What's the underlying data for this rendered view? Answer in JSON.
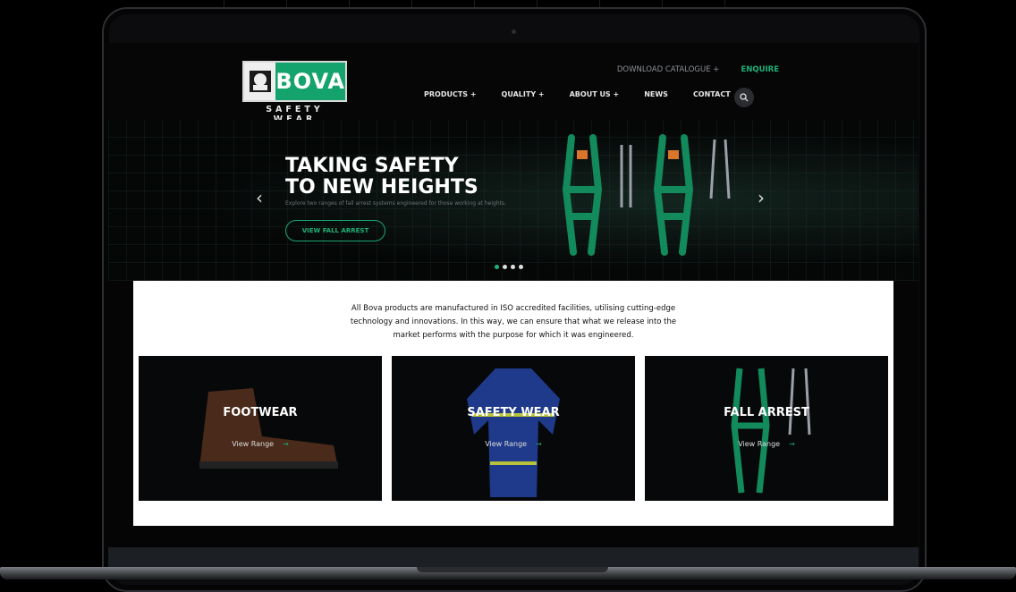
{
  "logo": {
    "name": "BOVA",
    "tagline": "SAFETY WEAR"
  },
  "top_links": {
    "download": "DOWNLOAD CATALOGUE +",
    "enquire": "ENQUIRE"
  },
  "nav": [
    "PRODUCTS +",
    "QUALITY +",
    "ABOUT US +",
    "NEWS",
    "CONTACT"
  ],
  "hero": {
    "title_line1": "TAKING SAFETY",
    "title_line2": "TO NEW HEIGHTS",
    "subtitle": "Explore two ranges of fall arrest systems engineered for those working at heights.",
    "button": "VIEW FALL ARREST",
    "slides": 4,
    "active_slide": 1
  },
  "intro": "All Bova products are manufactured in ISO accredited facilities, utilising cutting-edge technology and innovations. In this way, we can ensure that what we release into the market performs with the purpose for which it was engineered.",
  "cards": [
    {
      "title": "FOOTWEAR",
      "link": "View Range"
    },
    {
      "title": "SAFETY WEAR",
      "link": "View Range"
    },
    {
      "title": "FALL ARREST",
      "link": "View Range"
    }
  ],
  "colors": {
    "accent": "#1cb278",
    "logo_green": "#14a36c",
    "background": "#050505"
  }
}
